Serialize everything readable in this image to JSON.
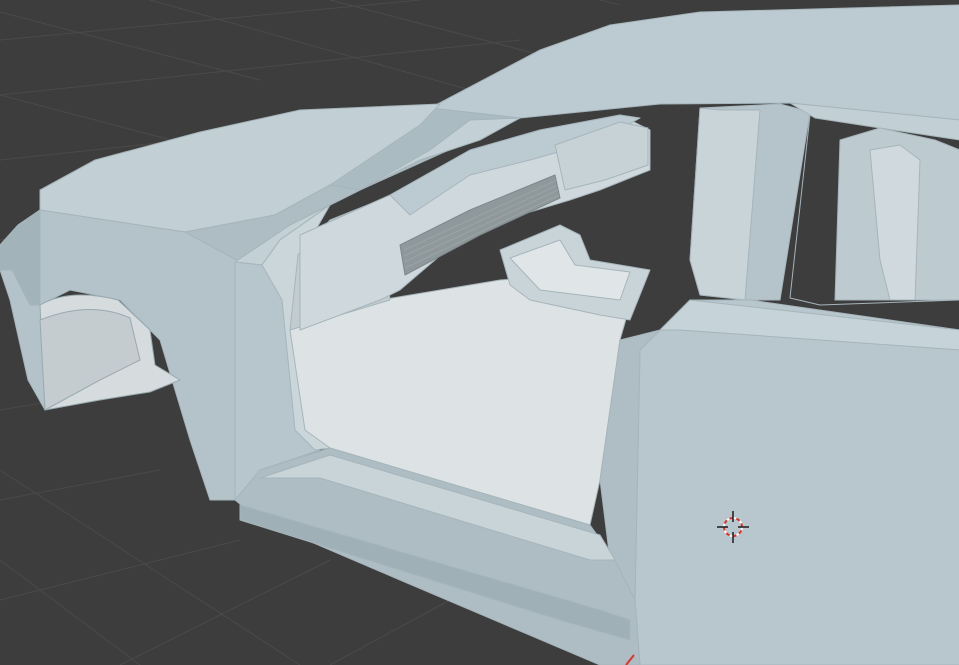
{
  "viewport": {
    "background_color": "#3d3d3d",
    "grid_color": "#4a4a4a",
    "cursor_color": "#d9352c",
    "cursor_icon": "3d-cursor-icon"
  },
  "scene": {
    "object": "car-body-mesh",
    "body_color": "#b9c8ce",
    "highlight_color": "#d9e2e6",
    "shadow_color": "#8fa2aa",
    "interior_color": "#dde3e5",
    "grille_color": "#8f989b"
  }
}
